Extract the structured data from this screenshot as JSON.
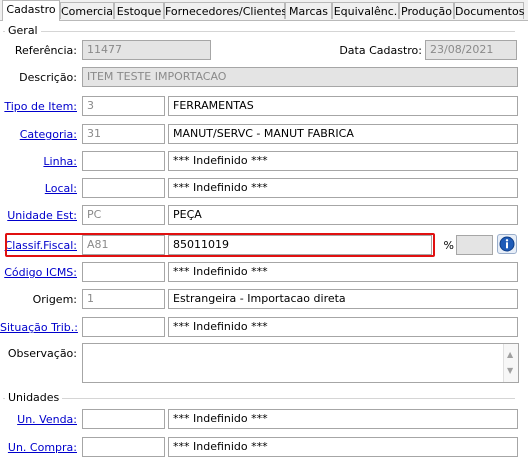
{
  "tabs": [
    "Cadastro",
    "Comercial",
    "Estoque",
    "Fornecedores/Clientes",
    "Marcas",
    "Equivalênc.",
    "Produção",
    "Documentos"
  ],
  "group_geral": "Geral",
  "group_unidades": "Unidades",
  "referencia": {
    "label": "Referência:",
    "value": "11477"
  },
  "data_cadastro": {
    "label": "Data Cadastro:",
    "value": "23/08/2021"
  },
  "descricao": {
    "label": "Descrição:",
    "value": "ITEM TESTE IMPORTACAO"
  },
  "tipo_item": {
    "label": "Tipo de Item:",
    "code": "3",
    "desc": "FERRAMENTAS"
  },
  "categoria": {
    "label": "Categoria:",
    "code": "31",
    "desc": "MANUT/SERVC - MANUT FABRICA"
  },
  "linha": {
    "label": "Linha:",
    "code": "",
    "desc": "*** Indefinido ***"
  },
  "local": {
    "label": "Local:",
    "code": "",
    "desc": "*** Indefinido ***"
  },
  "unidade_est": {
    "label": "Unidade Est:",
    "code": "PC",
    "desc": "PEÇA"
  },
  "classif_fiscal": {
    "label": "Classif.Fiscal:",
    "code": "A81",
    "desc": "85011019",
    "percent_label": "%",
    "percent_value": ""
  },
  "codigo_icms": {
    "label": "Código ICMS:",
    "code": "",
    "desc": "*** Indefinido ***"
  },
  "origem": {
    "label": "Origem:",
    "code": "1",
    "desc": "Estrangeira - Importacao direta"
  },
  "situacao_trib": {
    "label": "Situação Trib.:",
    "code": "",
    "desc": "*** Indefinido ***"
  },
  "observacao": {
    "label": "Observação:",
    "value": ""
  },
  "un_venda": {
    "label": "Un. Venda:",
    "code": "",
    "desc": "*** Indefinido ***"
  },
  "un_compra": {
    "label": "Un. Compra:",
    "code": "",
    "desc": "*** Indefinido ***"
  },
  "colors": {
    "highlight": "#e01010",
    "link": "#0000cc",
    "info": "#1e5bb8"
  },
  "icons": {
    "info": "info-icon",
    "scroll_up": "scroll-up-icon",
    "scroll_down": "scroll-down-icon"
  }
}
